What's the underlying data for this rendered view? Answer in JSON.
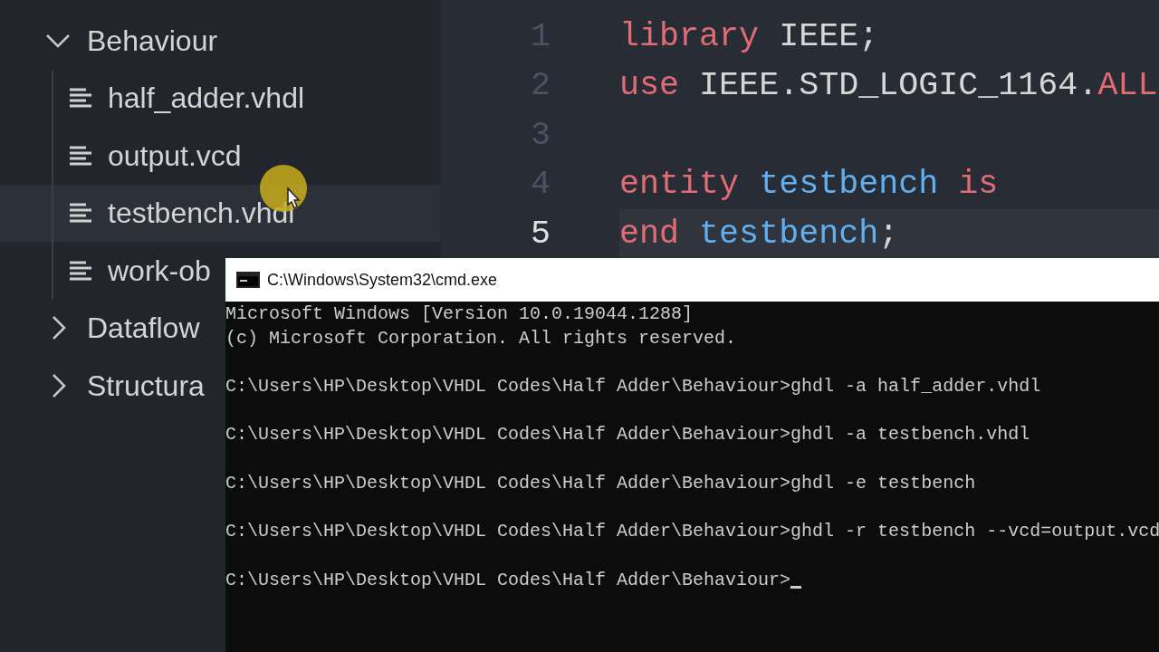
{
  "explorer": {
    "tree": [
      {
        "label": "Behaviour",
        "kind": "folder",
        "expanded": true,
        "selected": false,
        "children": [
          {
            "label": "half_adder.vhdl",
            "kind": "file",
            "selected": false
          },
          {
            "label": "output.vcd",
            "kind": "file",
            "selected": false
          },
          {
            "label": "testbench.vhdl",
            "kind": "file",
            "selected": true
          },
          {
            "label": "work-ob",
            "kind": "file",
            "selected": false
          }
        ]
      },
      {
        "label": "Dataflow",
        "kind": "folder",
        "expanded": false,
        "selected": false
      },
      {
        "label": "Structura",
        "kind": "folder",
        "expanded": false,
        "selected": false
      }
    ]
  },
  "editor": {
    "lines": [
      {
        "number": "1",
        "current": false,
        "tokens": [
          {
            "text": "library",
            "kind": "keyword"
          },
          {
            "text": " IEEE;",
            "kind": "plain"
          }
        ]
      },
      {
        "number": "2",
        "current": false,
        "tokens": [
          {
            "text": "use",
            "kind": "keyword"
          },
          {
            "text": " IEEE.STD_LOGIC_1164.",
            "kind": "plain"
          },
          {
            "text": "ALL",
            "kind": "keyword"
          }
        ]
      },
      {
        "number": "3",
        "current": false
      },
      {
        "number": "4",
        "current": false,
        "tokens": [
          {
            "text": "entity",
            "kind": "keyword"
          },
          {
            "text": " testbench",
            "kind": "identifier"
          },
          {
            "text": " is",
            "kind": "keyword"
          }
        ]
      },
      {
        "number": "5",
        "current": true,
        "tokens": [
          {
            "text": "end",
            "kind": "keyword"
          },
          {
            "text": " testbench",
            "kind": "identifier"
          },
          {
            "text": ";",
            "kind": "plain"
          }
        ]
      }
    ]
  },
  "terminal": {
    "title": "C:\\Windows\\System32\\cmd.exe",
    "lines": [
      {
        "text": "Microsoft Windows [Version 10.0.19044.1288]",
        "blank_before": false,
        "cursor": false
      },
      {
        "text": "(c) Microsoft Corporation. All rights reserved.",
        "blank_before": false,
        "cursor": false
      },
      {
        "text": "C:\\Users\\HP\\Desktop\\VHDL Codes\\Half Adder\\Behaviour>ghdl -a half_adder.vhdl",
        "blank_before": true,
        "cursor": false
      },
      {
        "text": "C:\\Users\\HP\\Desktop\\VHDL Codes\\Half Adder\\Behaviour>ghdl -a testbench.vhdl",
        "blank_before": true,
        "cursor": false
      },
      {
        "text": "C:\\Users\\HP\\Desktop\\VHDL Codes\\Half Adder\\Behaviour>ghdl -e testbench",
        "blank_before": true,
        "cursor": false
      },
      {
        "text": "C:\\Users\\HP\\Desktop\\VHDL Codes\\Half Adder\\Behaviour>ghdl -r testbench --vcd=output.vcd",
        "blank_before": true,
        "cursor": false
      },
      {
        "text": "C:\\Users\\HP\\Desktop\\VHDL Codes\\Half Adder\\Behaviour>",
        "blank_before": true,
        "cursor": true
      }
    ]
  }
}
